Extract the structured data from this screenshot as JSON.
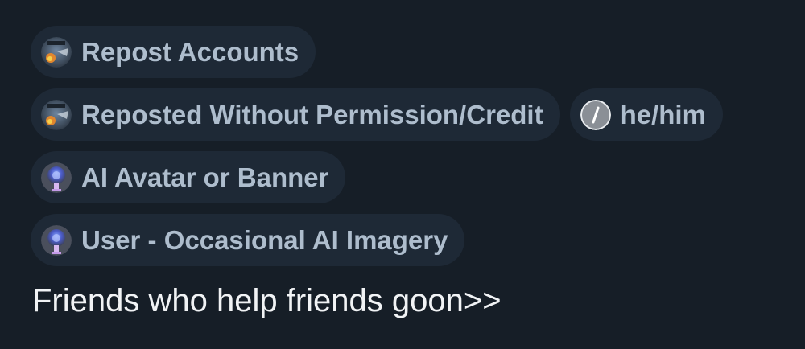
{
  "labels": [
    {
      "text": "Repost Accounts",
      "icon": "repost-avatar-icon"
    },
    {
      "text": "Reposted Without Permission/Credit",
      "icon": "repost-avatar-icon"
    },
    {
      "text": "he/him",
      "icon": "pronoun-slash-icon"
    },
    {
      "text": "AI Avatar or Banner",
      "icon": "ai-robot-icon"
    },
    {
      "text": "User - Occasional AI Imagery",
      "icon": "ai-robot-icon"
    }
  ],
  "bio": "Friends who help friends goon>>",
  "colors": {
    "background": "#161e27",
    "pill": "#1e2936",
    "pill_text": "#aebdcd",
    "bio_text": "#f1f3f5"
  }
}
